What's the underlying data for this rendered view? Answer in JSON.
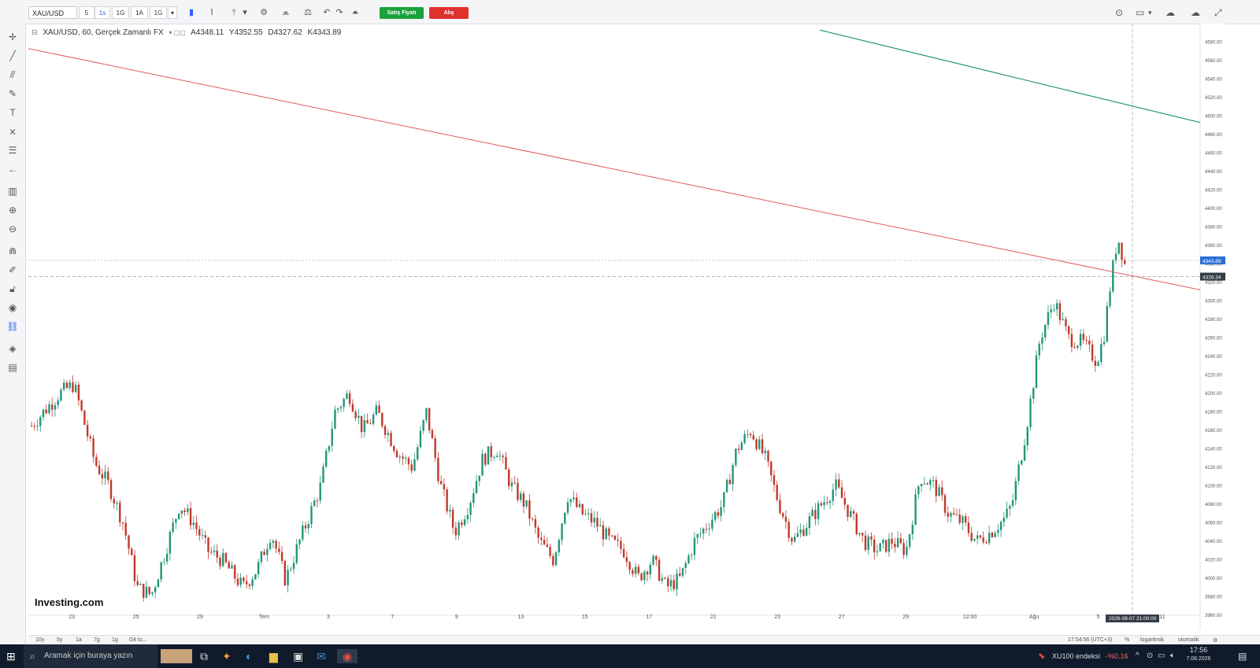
{
  "toolbar": {
    "symbol": "XAU/USD",
    "timeframes": [
      "5",
      "1s",
      "1G",
      "1A",
      "1G"
    ],
    "sell_label": "Satış Fiyatı",
    "buy_label": "Alış"
  },
  "legend": {
    "title": "XAU/USD, 60, Gerçek Zamanlı FX",
    "open": "A4348.11",
    "high": "Y4352.55",
    "low": "D4327.62",
    "close": "K4343.89"
  },
  "chart_data": {
    "type": "candlestick",
    "symbol": "XAU/USD",
    "interval": "60",
    "ylim": [
      3960,
      4600
    ],
    "y_ticks": [
      3960,
      3980,
      4000,
      4020,
      4040,
      4060,
      4080,
      4100,
      4120,
      4140,
      4160,
      4180,
      4200,
      4220,
      4240,
      4260,
      4280,
      4300,
      4320,
      4340,
      4360,
      4380,
      4400,
      4420,
      4440,
      4460,
      4480,
      4500,
      4520,
      4540,
      4560,
      4580
    ],
    "x_labels": [
      "23",
      "25",
      "29",
      "Tem",
      "3",
      "7",
      "9",
      "13",
      "15",
      "17",
      "21",
      "23",
      "27",
      "29",
      "12:00",
      "Ağu",
      "5",
      "11"
    ],
    "price_path": [
      [
        0,
        4165
      ],
      [
        4,
        4200
      ],
      [
        6,
        4210
      ],
      [
        9,
        4125
      ],
      [
        11,
        4100
      ],
      [
        13,
        4060
      ],
      [
        15,
        3990
      ],
      [
        17,
        3982
      ],
      [
        19,
        4030
      ],
      [
        21,
        4080
      ],
      [
        23,
        4060
      ],
      [
        25,
        4030
      ],
      [
        27,
        4020
      ],
      [
        30,
        3990
      ],
      [
        32,
        4010
      ],
      [
        34,
        4050
      ],
      [
        36,
        3998
      ],
      [
        38,
        4040
      ],
      [
        39,
        4060
      ],
      [
        41,
        4100
      ],
      [
        43,
        4180
      ],
      [
        45,
        4200
      ],
      [
        47,
        4160
      ],
      [
        49,
        4180
      ],
      [
        52,
        4135
      ],
      [
        54,
        4120
      ],
      [
        56,
        4180
      ],
      [
        58,
        4100
      ],
      [
        60,
        4050
      ],
      [
        62,
        4080
      ],
      [
        64,
        4130
      ],
      [
        66,
        4140
      ],
      [
        68,
        4100
      ],
      [
        70,
        4080
      ],
      [
        72,
        4040
      ],
      [
        74,
        4020
      ],
      [
        76,
        4090
      ],
      [
        78,
        4070
      ],
      [
        80,
        4060
      ],
      [
        82,
        4040
      ],
      [
        84,
        4030
      ],
      [
        86,
        4000
      ],
      [
        88,
        4020
      ],
      [
        90,
        3990
      ],
      [
        92,
        4000
      ],
      [
        94,
        4040
      ],
      [
        96,
        4060
      ],
      [
        98,
        4080
      ],
      [
        100,
        4140
      ],
      [
        102,
        4160
      ],
      [
        104,
        4130
      ],
      [
        106,
        4080
      ],
      [
        108,
        4040
      ],
      [
        110,
        4060
      ],
      [
        112,
        4080
      ],
      [
        114,
        4100
      ],
      [
        116,
        4070
      ],
      [
        118,
        4040
      ],
      [
        120,
        4030
      ],
      [
        122,
        4040
      ],
      [
        124,
        4030
      ],
      [
        126,
        4110
      ],
      [
        128,
        4100
      ],
      [
        130,
        4070
      ],
      [
        132,
        4060
      ],
      [
        134,
        4040
      ],
      [
        136,
        4050
      ],
      [
        138,
        4065
      ],
      [
        139,
        4080
      ],
      [
        141,
        4160
      ],
      [
        143,
        4260
      ],
      [
        145,
        4300
      ],
      [
        147,
        4260
      ],
      [
        149,
        4255
      ],
      [
        151,
        4235
      ],
      [
        152,
        4260
      ],
      [
        153,
        4320
      ],
      [
        154,
        4370
      ],
      [
        155,
        4340
      ]
    ],
    "price_label": "4343.89",
    "crosshair_price": "4326.34",
    "crosshair_time": "2026-08-07 21:00:00",
    "trendlines": [
      {
        "color": "#e05b5b"
      },
      {
        "color": "#22957a"
      }
    ],
    "grid": true
  },
  "bottom": {
    "ranges": [
      "10y",
      "5y",
      "1a",
      "7g",
      "1g",
      "Git to..."
    ],
    "time": "17:54:56 (UTC+3)",
    "pct": "%",
    "log": "logaritmik",
    "auto": "otomatik"
  },
  "watermark": "Investing.com",
  "taskbar": {
    "search_placeholder": "Aramak için buraya yazın",
    "ticker": "XU100 endeksi",
    "ticker_change": "-%0.16",
    "clock_time": "17:56",
    "clock_date": "7.08.2026"
  }
}
